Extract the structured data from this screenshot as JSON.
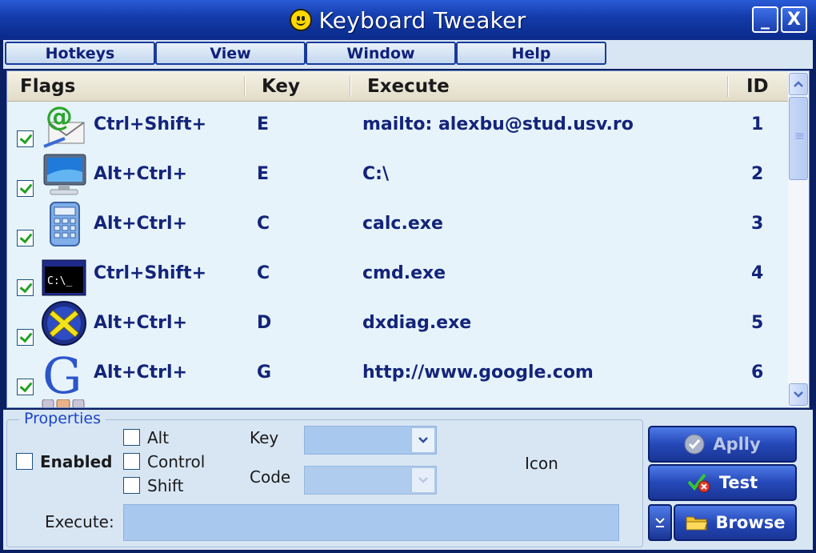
{
  "window": {
    "title": "Keyboard Tweaker",
    "minimize_glyph": "_",
    "close_glyph": "X"
  },
  "menu": [
    "Hotkeys",
    "View",
    "Window",
    "Help"
  ],
  "list": {
    "columns": [
      "Flags",
      "Key",
      "Execute",
      "ID"
    ],
    "rows": [
      {
        "checked": true,
        "icon": "mail-icon",
        "flags": "Ctrl+Shift+",
        "key": "E",
        "execute": "mailto: alexbu@stud.usv.ro",
        "id": "1"
      },
      {
        "checked": true,
        "icon": "computer-monitor-icon",
        "flags": "Alt+Ctrl+",
        "key": "E",
        "execute": "C:\\",
        "id": "2"
      },
      {
        "checked": true,
        "icon": "calculator-icon",
        "flags": "Alt+Ctrl+",
        "key": "C",
        "execute": "calc.exe",
        "id": "3"
      },
      {
        "checked": true,
        "icon": "command-prompt-icon",
        "flags": "Ctrl+Shift+",
        "key": "C",
        "execute": "cmd.exe",
        "id": "4"
      },
      {
        "checked": true,
        "icon": "directx-icon",
        "flags": "Alt+Ctrl+",
        "key": "D",
        "execute": "dxdiag.exe",
        "id": "5"
      },
      {
        "checked": true,
        "icon": "google-icon",
        "flags": "Alt+Ctrl+",
        "key": "G",
        "execute": "http://www.google.com",
        "id": "6"
      }
    ]
  },
  "properties": {
    "legend": "Properties",
    "enabled_label": "Enabled",
    "modifiers": [
      "Alt",
      "Control",
      "Shift"
    ],
    "key_label": "Key",
    "code_label": "Code",
    "icon_label": "Icon",
    "execute_label": "Execute:",
    "key_value": "",
    "code_value": "",
    "execute_value": ""
  },
  "buttons": {
    "apply": "Aplly",
    "test": "Test",
    "browse": "Browse"
  },
  "colors": {
    "title_bar": "#123aa8",
    "list_background": "#e6f3fb",
    "text_blue": "#14247a",
    "check_green": "#21a121"
  }
}
